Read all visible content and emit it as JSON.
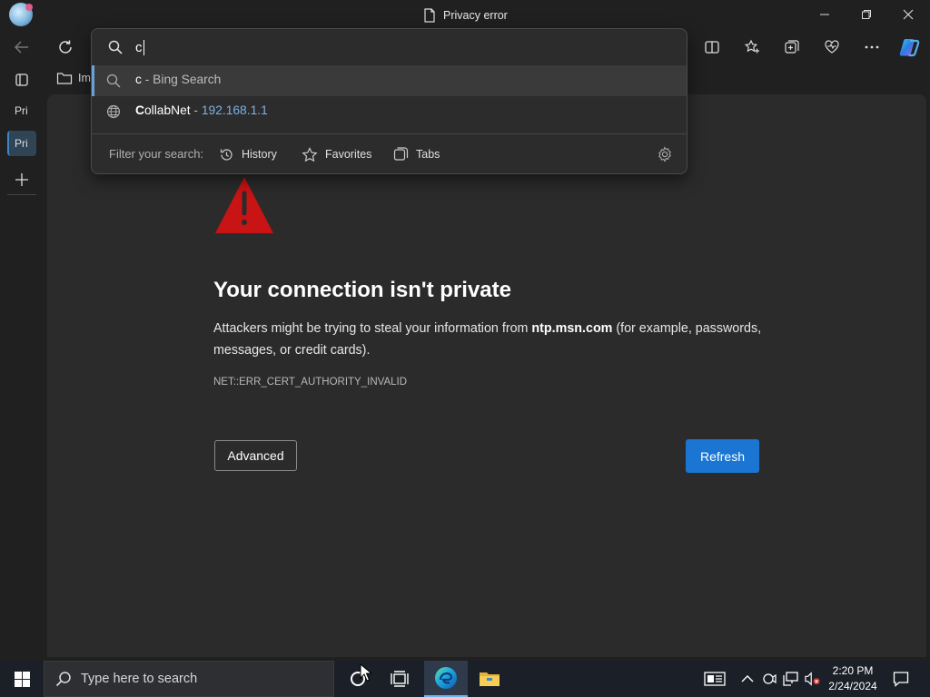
{
  "window": {
    "title": "Privacy error"
  },
  "sidebar": {
    "tabs": [
      {
        "label": "Pri"
      },
      {
        "label": "Pri"
      }
    ]
  },
  "favorites_bar": {
    "items": [
      {
        "label": "Im"
      }
    ]
  },
  "omnibox": {
    "query": "c",
    "suggestions": [
      {
        "bold": "c",
        "separator": " - ",
        "rest": "Bing Search"
      },
      {
        "bold": "C",
        "rest": "ollabNet",
        "separator": " - ",
        "url": "192.168.1.1"
      }
    ],
    "filter_label": "Filter your search:",
    "filters": [
      "History",
      "Favorites",
      "Tabs"
    ]
  },
  "page": {
    "heading": "Your connection isn't private",
    "desc_before": "Attackers might be trying to steal your information from ",
    "desc_host": "ntp.msn.com",
    "desc_after": " (for example, passwords, messages, or credit cards).",
    "error_code": "NET::ERR_CERT_AUTHORITY_INVALID",
    "advanced_label": "Advanced",
    "refresh_label": "Refresh"
  },
  "taskbar": {
    "search_placeholder": "Type here to search",
    "time": "2:20 PM",
    "date": "2/24/2024"
  },
  "colors": {
    "accent": "#1a76d2",
    "warning": "#c81414",
    "background": "#202020",
    "page": "#2b2b2b"
  }
}
